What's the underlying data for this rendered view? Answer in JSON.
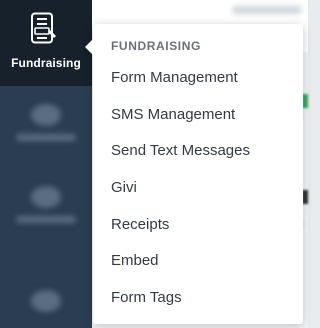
{
  "sidebar": {
    "active_item": {
      "label": "Fundraising",
      "icon": "form-list-icon"
    }
  },
  "flyout": {
    "heading": "FUNDRAISING",
    "items": [
      {
        "label": "Form Management"
      },
      {
        "label": "SMS Management"
      },
      {
        "label": "Send Text Messages"
      },
      {
        "label": "Givi"
      },
      {
        "label": "Receipts"
      },
      {
        "label": "Embed"
      },
      {
        "label": "Form Tags"
      }
    ]
  },
  "colors": {
    "sidebar_bg": "#2b3d50",
    "sidebar_active_bg": "#17212b",
    "flyout_bg": "#ffffff",
    "heading_text": "#6b7079",
    "item_text": "#333a44"
  }
}
